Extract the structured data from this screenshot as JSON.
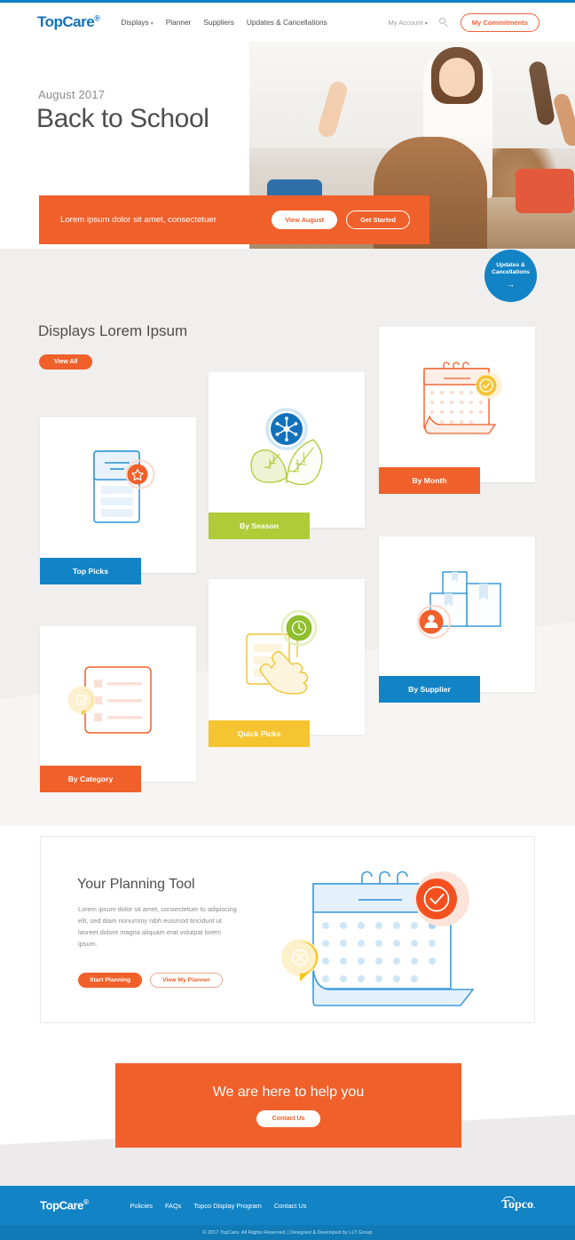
{
  "header": {
    "logo": "TopCare",
    "logo_reg": "®",
    "nav": [
      {
        "label": "Displays",
        "has_caret": true
      },
      {
        "label": "Planner",
        "has_caret": false
      },
      {
        "label": "Suppliers",
        "has_caret": false
      },
      {
        "label": "Updates & Cancellations",
        "has_caret": false
      }
    ],
    "account_label": "My Account",
    "search_icon": "search-icon",
    "commitments_button": "My Commitments"
  },
  "hero": {
    "eyebrow": "August 2017",
    "title": "Back to School",
    "band_text": "Lorem ipsum dolor sit amet, consectetuer",
    "primary_button": "View August",
    "secondary_button": "Get Started",
    "badge_line1": "Updates &",
    "badge_line2": "Cancellations",
    "badge_arrow": "→"
  },
  "displays": {
    "section_title": "Displays Lorem Ipsum",
    "view_all_button": "View All",
    "cards": [
      {
        "label": "By Month",
        "color": "#f0602a",
        "icon": "calendar-check-icon"
      },
      {
        "label": "By Season",
        "color": "#afcb37",
        "icon": "leaves-snowflake-icon"
      },
      {
        "label": "Top Picks",
        "color": "#1284c6",
        "icon": "document-star-icon"
      },
      {
        "label": "By Supplier",
        "color": "#1284c6",
        "icon": "boxes-person-icon"
      },
      {
        "label": "Quick Picks",
        "color": "#f5c431",
        "icon": "hand-clock-icon"
      },
      {
        "label": "By Category",
        "color": "#f0602a",
        "icon": "checklist-edit-icon"
      }
    ]
  },
  "planning": {
    "title": "Your Planning Tool",
    "body": "Lorem ipsum dolor sit amet, consectetuer tu adipiscing elit, sed diam nonummy nibh euismod tincidunt ut laoreet dolore magna aliquam erat volutpat lorem ipsum.",
    "primary_button": "Start Planning",
    "secondary_button": "View My Planner",
    "illustration": "calendar-check-cancel-icon"
  },
  "cta": {
    "title": "We are here to help you",
    "button": "Contact Us"
  },
  "footer": {
    "logo": "TopCare",
    "logo_reg": "®",
    "links": [
      "Policies",
      "FAQs",
      "Topco Display Program",
      "Contact Us"
    ],
    "brand": "Topco",
    "brand_reg": ".",
    "copyright": "© 2017 TopCare. All Rights Reserved.  |  Designed & Developed by LLT Group"
  },
  "colors": {
    "brand_blue": "#1284c6",
    "accent_orange": "#f0602a",
    "green": "#afcb37",
    "yellow": "#f5c431",
    "grey_bg": "#f0efee"
  }
}
